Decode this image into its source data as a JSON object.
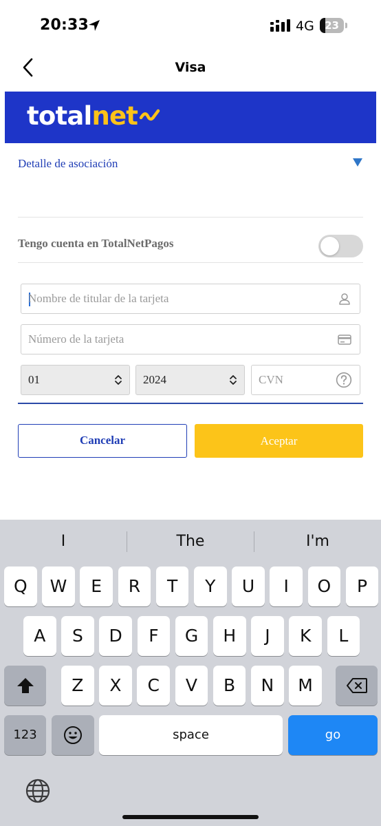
{
  "status_bar": {
    "time": "20:33",
    "network": "4G",
    "battery_level": "23",
    "battery_fraction": 0.23
  },
  "nav": {
    "title": "Visa",
    "back_icon": "chevron-left-icon"
  },
  "banner": {
    "logo_part1": "total",
    "logo_part2": "net",
    "brand_color": "#1e35c8",
    "accent_color": "#fcc219"
  },
  "association": {
    "label": "Detalle de asociación",
    "caret_icon": "triangle-down-icon"
  },
  "account_toggle": {
    "label": "Tengo cuenta en TotalNetPagos",
    "on": false
  },
  "form": {
    "cardholder_placeholder": "Nombre de titular de la tarjeta",
    "cardholder_value": "",
    "card_number_placeholder": "Número de la tarjeta",
    "card_number_value": "",
    "month_value": "01",
    "year_value": "2024",
    "cvn_placeholder": "CVN",
    "cvn_value": ""
  },
  "buttons": {
    "cancel_label": "Cancelar",
    "accept_label": "Aceptar"
  },
  "keyboard": {
    "suggestions": [
      "I",
      "The",
      "I'm"
    ],
    "row1": [
      "Q",
      "W",
      "E",
      "R",
      "T",
      "Y",
      "U",
      "I",
      "O",
      "P"
    ],
    "row2": [
      "A",
      "S",
      "D",
      "F",
      "G",
      "H",
      "J",
      "K",
      "L"
    ],
    "row3": [
      "Z",
      "X",
      "C",
      "V",
      "B",
      "N",
      "M"
    ],
    "numbers_label": "123",
    "space_label": "space",
    "go_label": "go"
  }
}
